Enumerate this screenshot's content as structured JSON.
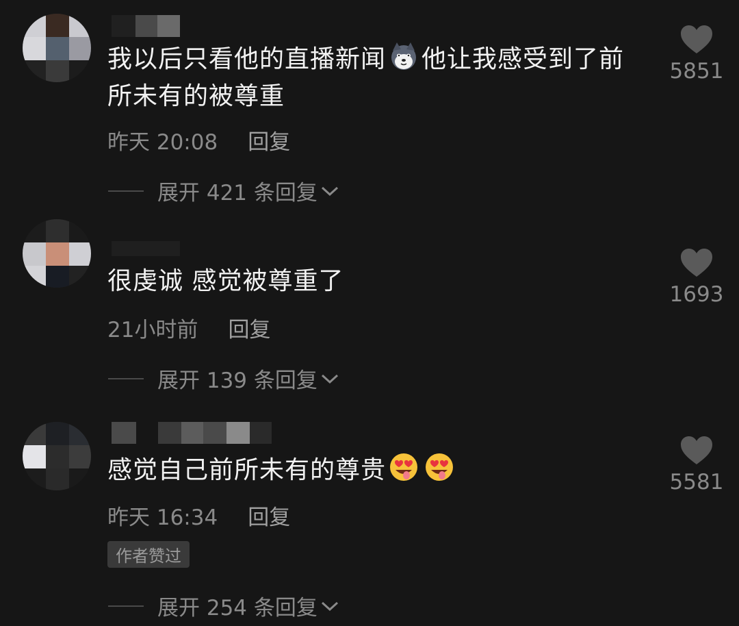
{
  "comments": [
    {
      "text_before": "我以后只看他的直播新闻",
      "text_after": "他让我感受到了前所未有的被尊重",
      "emoji_after_text_before": "husky-dog-emoji",
      "time": "昨天 20:08",
      "reply_label": "回复",
      "expand_label": "展开 421 条回复",
      "likes": "5851"
    },
    {
      "text": "很虔诚 感觉被尊重了",
      "time": "21小时前",
      "reply_label": "回复",
      "expand_label": "展开 139 条回复",
      "likes": "1693"
    },
    {
      "text": "感觉自己前所未有的尊贵",
      "emojis": [
        "heart-eyes-tongue-emoji",
        "heart-eyes-tongue-emoji"
      ],
      "time": "昨天 16:34",
      "reply_label": "回复",
      "author_liked_label": "作者赞过",
      "expand_label": "展开 254 条回复",
      "likes": "5581"
    }
  ],
  "colors": {
    "background": "#161616",
    "text": "#f2f2f2",
    "secondary": "#8a8a8a",
    "heart": "#5a5a5a"
  }
}
